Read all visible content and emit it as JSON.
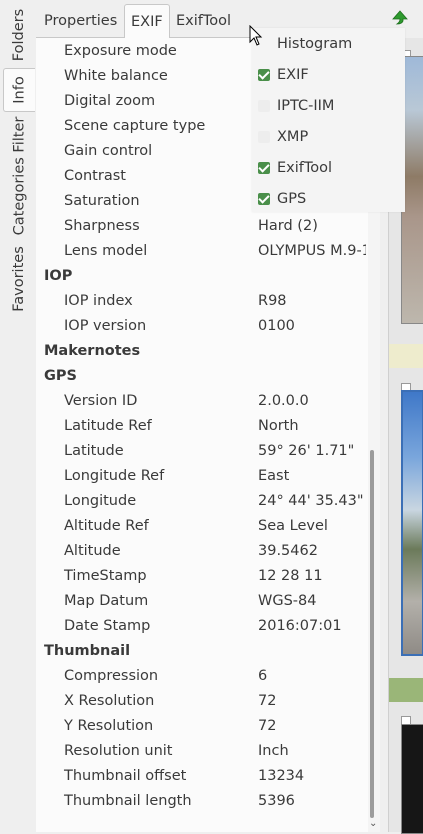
{
  "left_tabs": [
    "Folders",
    "Info",
    "Categories Filter",
    "Favorites"
  ],
  "top_tabs": [
    "Properties",
    "EXIF",
    "ExifTool"
  ],
  "menu": {
    "items": [
      {
        "label": "Histogram",
        "checkbox": null
      },
      {
        "label": "EXIF",
        "checkbox": true
      },
      {
        "label": "IPTC-IIM",
        "checkbox": false
      },
      {
        "label": "XMP",
        "checkbox": false
      },
      {
        "label": "ExifTool",
        "checkbox": true
      },
      {
        "label": "GPS",
        "checkbox": true
      }
    ]
  },
  "rows": [
    {
      "key": "Exposure mode",
      "value": ""
    },
    {
      "key": "White balance",
      "value": ""
    },
    {
      "key": "Digital zoom",
      "value": ""
    },
    {
      "key": "Scene capture type",
      "value": ""
    },
    {
      "key": "Gain control",
      "value": ""
    },
    {
      "key": "Contrast",
      "value": ""
    },
    {
      "key": "Saturation",
      "value": ""
    },
    {
      "key": "Sharpness",
      "value": "Hard (2)"
    },
    {
      "key": "Lens model",
      "value": "OLYMPUS M.9-1"
    },
    {
      "key": "IOP",
      "value": "",
      "section": true
    },
    {
      "key": "IOP index",
      "value": "R98"
    },
    {
      "key": "IOP version",
      "value": "0100"
    },
    {
      "key": "Makernotes",
      "value": "",
      "section": true
    },
    {
      "key": "GPS",
      "value": "",
      "section": true
    },
    {
      "key": "Version ID",
      "value": "2.0.0.0"
    },
    {
      "key": "Latitude Ref",
      "value": "North"
    },
    {
      "key": "Latitude",
      "value": "59° 26' 1.71\""
    },
    {
      "key": "Longitude Ref",
      "value": "East"
    },
    {
      "key": "Longitude",
      "value": "24° 44' 35.43\""
    },
    {
      "key": "Altitude Ref",
      "value": "Sea Level"
    },
    {
      "key": "Altitude",
      "value": "39.5462"
    },
    {
      "key": "TimeStamp",
      "value": "12 28 11"
    },
    {
      "key": "Map Datum",
      "value": "WGS-84"
    },
    {
      "key": "Date Stamp",
      "value": "2016:07:01"
    },
    {
      "key": "Thumbnail",
      "value": "",
      "section": true
    },
    {
      "key": "Compression",
      "value": "6"
    },
    {
      "key": "X Resolution",
      "value": "72"
    },
    {
      "key": "Y Resolution",
      "value": "72"
    },
    {
      "key": "Resolution unit",
      "value": "Inch"
    },
    {
      "key": "Thumbnail offset",
      "value": "13234"
    },
    {
      "key": "Thumbnail length",
      "value": "5396"
    }
  ],
  "colors": {
    "check_green": "#4a8f4a",
    "up_arrow": "#2e9a2e",
    "thumb_band_1": "#eeeccd",
    "thumb_band_2": "#9ab678"
  }
}
